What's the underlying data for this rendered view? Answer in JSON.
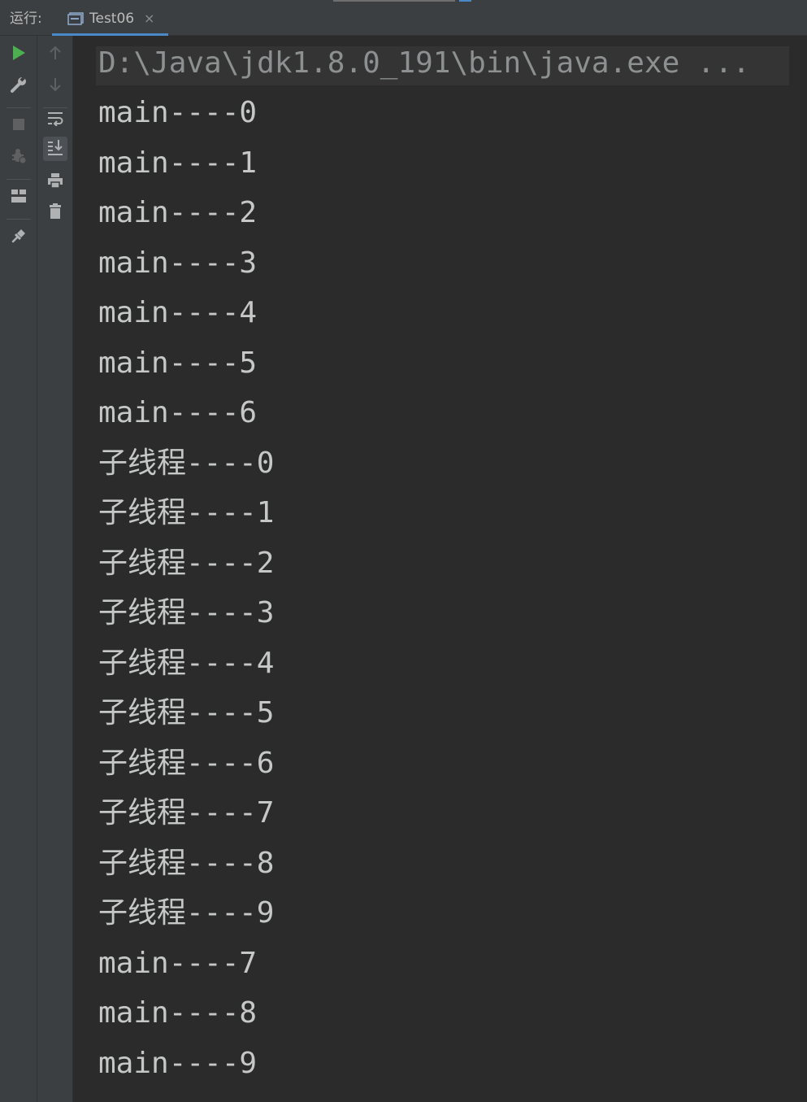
{
  "run_panel": {
    "label": "运行:",
    "tab": {
      "title": "Test06",
      "close_glyph": "×"
    }
  },
  "toolbar_icons": {
    "left": [
      "rerun-icon",
      "wrench-icon",
      "stop-icon",
      "debug-icon",
      "layout-icon",
      "pin-icon"
    ],
    "right": [
      "scroll-up-icon",
      "scroll-down-icon",
      "soft-wrap-icon",
      "scroll-to-end-icon",
      "print-icon",
      "trash-icon"
    ]
  },
  "console": {
    "command": "D:\\Java\\jdk1.8.0_191\\bin\\java.exe ...",
    "lines": [
      "main----0",
      "main----1",
      "main----2",
      "main----3",
      "main----4",
      "main----5",
      "main----6",
      "子线程----0",
      "子线程----1",
      "子线程----2",
      "子线程----3",
      "子线程----4",
      "子线程----5",
      "子线程----6",
      "子线程----7",
      "子线程----8",
      "子线程----9",
      "main----7",
      "main----8",
      "main----9"
    ]
  },
  "colors": {
    "background": "#2b2b2b",
    "panel": "#3c3f41",
    "accent": "#4a88c7",
    "run_green": "#4caf50",
    "text": "#c5c8c6",
    "command_text": "#8d9090"
  }
}
